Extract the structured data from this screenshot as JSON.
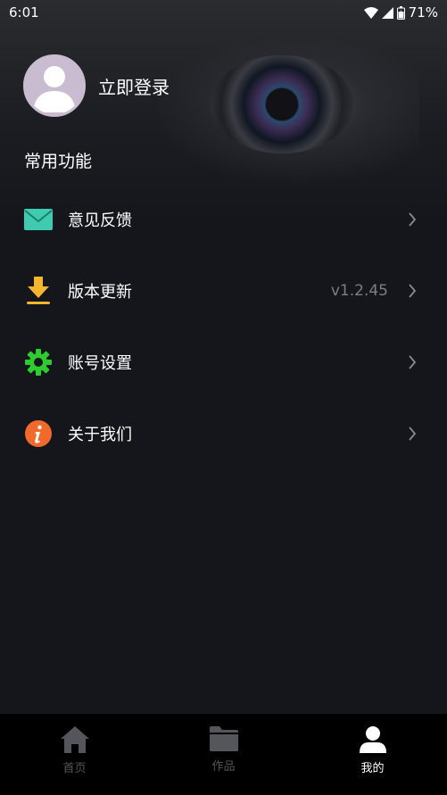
{
  "status_bar": {
    "time": "6:01",
    "battery": "71%"
  },
  "profile": {
    "login_label": "立即登录"
  },
  "section": {
    "title": "常用功能"
  },
  "menu": {
    "items": [
      {
        "label": "意见反馈",
        "icon": "mail-icon",
        "value": ""
      },
      {
        "label": "版本更新",
        "icon": "download-icon",
        "value": "v1.2.45"
      },
      {
        "label": "账号设置",
        "icon": "gear-icon",
        "value": ""
      },
      {
        "label": "关于我们",
        "icon": "info-icon",
        "value": ""
      }
    ]
  },
  "bottom_nav": {
    "items": [
      {
        "label": "首页",
        "icon": "home-icon",
        "active": false
      },
      {
        "label": "作品",
        "icon": "folder-icon",
        "active": false
      },
      {
        "label": "我的",
        "icon": "person-icon",
        "active": true
      }
    ]
  },
  "colors": {
    "background": "#15161b",
    "mail_icon": "#3ecbb0",
    "download_icon": "#f5b62f",
    "gear_icon": "#2ecc2e",
    "info_icon": "#f26a2b",
    "nav_inactive": "#55565c",
    "nav_active": "#ffffff"
  }
}
